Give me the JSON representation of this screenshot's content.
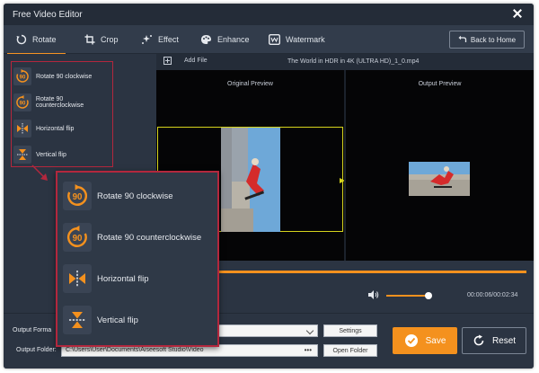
{
  "window": {
    "title": "Free Video Editor"
  },
  "tabs": [
    {
      "label": "Rotate",
      "icon": "rotate-icon",
      "active": true
    },
    {
      "label": "Crop",
      "icon": "crop-icon",
      "active": false
    },
    {
      "label": "Effect",
      "icon": "effect-icon",
      "active": false
    },
    {
      "label": "Enhance",
      "icon": "palette-icon",
      "active": false
    },
    {
      "label": "Watermark",
      "icon": "watermark-icon",
      "active": false
    }
  ],
  "back_home": {
    "label": "Back to Home"
  },
  "rotation_options": [
    {
      "label": "Rotate 90 clockwise",
      "icon": "rotate-cw-90-icon"
    },
    {
      "label": "Rotate 90 counterclockwise",
      "icon": "rotate-ccw-90-icon"
    },
    {
      "label": "Horizontal flip",
      "icon": "horizontal-flip-icon"
    },
    {
      "label": "Vertical flip",
      "icon": "vertical-flip-icon"
    }
  ],
  "file_bar": {
    "add_file": "Add File",
    "filename": "The World in HDR in 4K (ULTRA HD)_1_0.mp4"
  },
  "preview": {
    "original_label": "Original Preview",
    "output_label": "Output Preview"
  },
  "player": {
    "time": "00:00:06/00:02:34",
    "volume": 0.85
  },
  "output": {
    "format_label": "Output Forma",
    "folder_label": "Output Folder:",
    "folder_path": "C:\\Users\\User\\Documents\\Aiseesoft Studio\\Video",
    "folder_dots": "•••",
    "settings_label": "Settings",
    "open_folder_label": "Open Folder"
  },
  "actions": {
    "save_label": "Save",
    "reset_label": "Reset"
  },
  "colors": {
    "accent": "#f4911e",
    "highlight_border": "#b3273d",
    "frame_border": "#d6d41c",
    "background": "#2b3442"
  }
}
